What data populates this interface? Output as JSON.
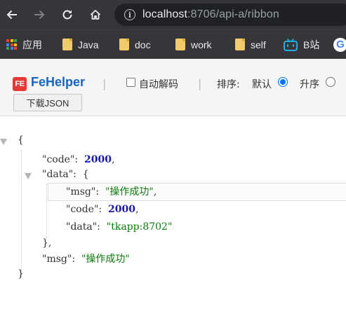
{
  "browser": {
    "url_host": "localhost",
    "url_path": ":8706/api-a/ribbon",
    "icons": [
      "back-icon",
      "forward-icon",
      "reload-icon",
      "home-icon",
      "info-icon"
    ]
  },
  "bookmarks": [
    {
      "label": "应用",
      "icon": "apps-icon"
    },
    {
      "label": "Java",
      "icon": "folder-icon"
    },
    {
      "label": "doc",
      "icon": "folder-icon"
    },
    {
      "label": "work",
      "icon": "folder-icon"
    },
    {
      "label": "self",
      "icon": "folder-icon"
    },
    {
      "label": "B站",
      "icon": "bilibili-icon"
    }
  ],
  "fehelper": {
    "logo_text": "FE",
    "title": "FeHelper",
    "separator": "|",
    "auto_decode_label": "自动解码",
    "auto_decode_checked": false,
    "sort_label": "排序:",
    "sort_default_label": "默认",
    "sort_asc_label": "升序",
    "sort_selected": "默认",
    "download_button": "下载JSON",
    "colors": {
      "title": "#1565c0",
      "logo": "#e53935",
      "radio": "#0075ff"
    }
  },
  "json": {
    "open_brace": "{",
    "close_brace": "}",
    "code_key": "\"code\"",
    "code_value": "2000",
    "data_key": "\"data\"",
    "data_open": "{",
    "data_close": "},",
    "msg_key": "\"msg\"",
    "msg_value": "\"操作成功\"",
    "inner_code_value": "2000",
    "inner_data_value": "\"tkapp:8702\"",
    "colon": ":",
    "comma": ",",
    "colors": {
      "number": "#1a1aa6",
      "string": "#0b7a0b"
    }
  }
}
